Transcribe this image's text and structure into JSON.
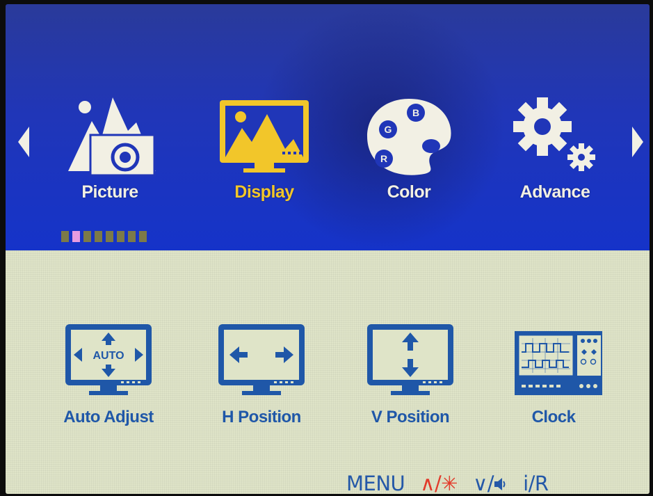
{
  "tabs": [
    {
      "id": "picture",
      "label": "Picture",
      "icon": "picture-icon",
      "active": false
    },
    {
      "id": "display",
      "label": "Display",
      "icon": "display-icon",
      "active": true
    },
    {
      "id": "color",
      "label": "Color",
      "icon": "color-palette-icon",
      "active": false
    },
    {
      "id": "advance",
      "label": "Advance",
      "icon": "gear-icon",
      "active": false
    }
  ],
  "palette_letters": {
    "b": "B",
    "g": "G",
    "r": "R"
  },
  "auto_icon_text": "AUTO",
  "page_indicator": {
    "count": 8,
    "active_index": 1
  },
  "items": [
    {
      "id": "auto-adjust",
      "label": "Auto Adjust",
      "icon": "auto-adjust-icon"
    },
    {
      "id": "h-position",
      "label": "H Position",
      "icon": "h-position-icon"
    },
    {
      "id": "v-position",
      "label": "V Position",
      "icon": "v-position-icon"
    },
    {
      "id": "clock",
      "label": "Clock",
      "icon": "clock-icon"
    }
  ],
  "hints": {
    "menu": "MENU",
    "up": "∧/✳",
    "down": "∨/",
    "down_icon": "volume-icon",
    "info": "i/R"
  },
  "colors": {
    "top_bg": "#1533c9",
    "bottom_bg": "#dfe4c8",
    "active_tab": "#f2c62a",
    "inactive_tab": "#f2f0e4",
    "item_blue": "#1f57a8",
    "hint_red": "#e23a2a"
  }
}
